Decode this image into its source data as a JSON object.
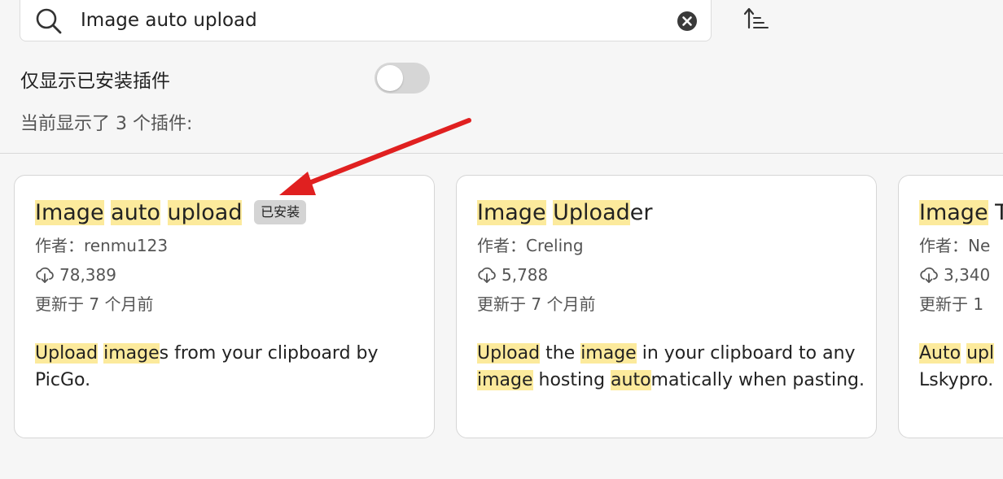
{
  "search": {
    "value": "Image auto upload",
    "icon": "search-icon",
    "clear_icon": "clear-icon"
  },
  "sort": {
    "icon": "sort-ascending-icon"
  },
  "filter": {
    "label": "仅显示已安装插件",
    "enabled": false
  },
  "results": {
    "count_text": "当前显示了 3 个插件:"
  },
  "highlight_color": "#fcea9c",
  "annotation": {
    "arrow_color": "#e02020"
  },
  "plugins": [
    {
      "title_parts": [
        {
          "text": "Image",
          "hl": true
        },
        {
          "text": " ",
          "hl": false
        },
        {
          "text": "auto",
          "hl": true
        },
        {
          "text": " ",
          "hl": false
        },
        {
          "text": "upload",
          "hl": true
        }
      ],
      "badge": "已安装",
      "author": "作者：renmu123",
      "downloads": "78,389",
      "updated": "更新于 7 个月前",
      "desc_parts": [
        {
          "text": "Upload",
          "hl": true
        },
        {
          "text": " ",
          "hl": false
        },
        {
          "text": "image",
          "hl": true
        },
        {
          "text": "s from your clipboard by PicGo.",
          "hl": false
        }
      ]
    },
    {
      "title_parts": [
        {
          "text": "Image",
          "hl": true
        },
        {
          "text": " ",
          "hl": false
        },
        {
          "text": "Upload",
          "hl": true
        },
        {
          "text": "er",
          "hl": false
        }
      ],
      "badge": "",
      "author": "作者：Creling",
      "downloads": "5,788",
      "updated": "更新于 7 个月前",
      "desc_parts": [
        {
          "text": "Upload",
          "hl": true
        },
        {
          "text": " the ",
          "hl": false
        },
        {
          "text": "image",
          "hl": true
        },
        {
          "text": " in your clipboard to any ",
          "hl": false
        },
        {
          "text": "image",
          "hl": true
        },
        {
          "text": " hosting ",
          "hl": false
        },
        {
          "text": "auto",
          "hl": true
        },
        {
          "text": "matically when pasting.",
          "hl": false
        }
      ]
    },
    {
      "title_parts": [
        {
          "text": "Image",
          "hl": true
        },
        {
          "text": " T",
          "hl": false
        }
      ],
      "badge": "",
      "author": "作者：Ne",
      "downloads": "3,340",
      "updated": "更新于 1",
      "desc_parts": [
        {
          "text": "Auto",
          "hl": true
        },
        {
          "text": " ",
          "hl": false
        },
        {
          "text": "upl",
          "hl": true
        },
        {
          "text": " Lskypro.",
          "hl": false
        }
      ]
    }
  ]
}
